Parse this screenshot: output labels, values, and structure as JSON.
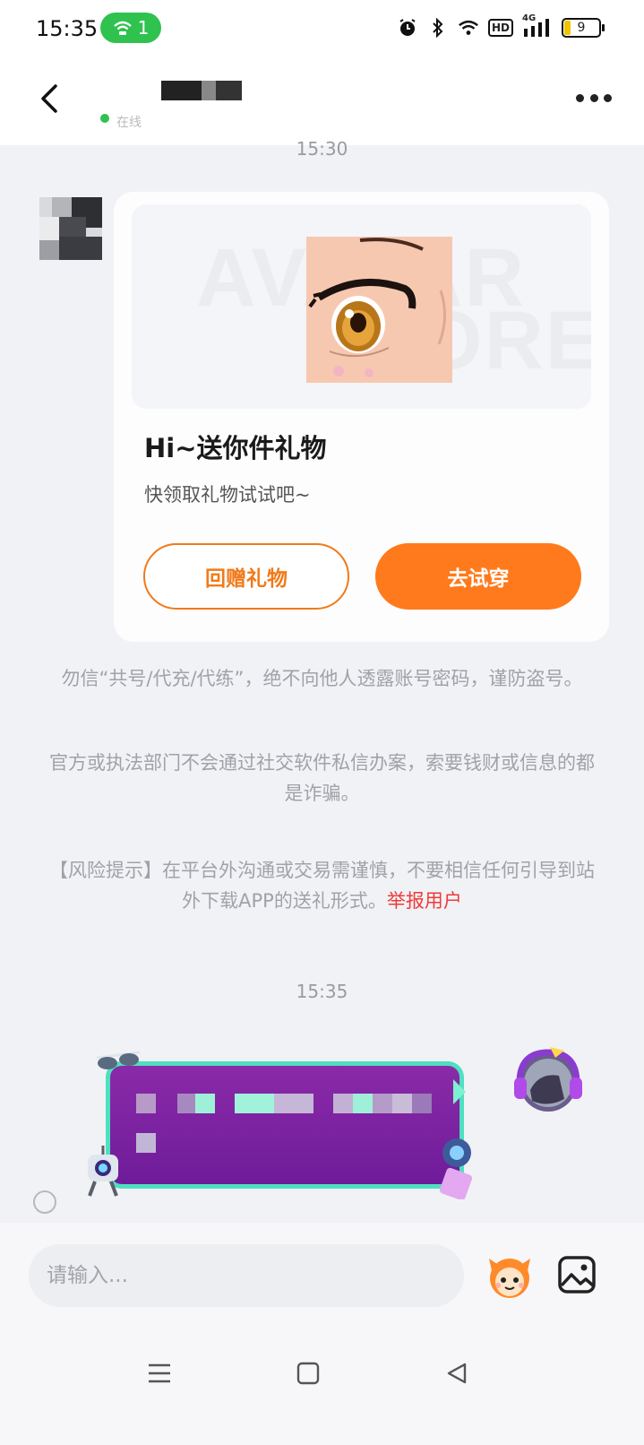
{
  "status_bar": {
    "time": "15:35",
    "hotspot_count": "1",
    "battery_level": "9",
    "network_label": "HD",
    "cellular_label": "4G"
  },
  "header": {
    "online_label": "在线"
  },
  "messages": [
    {
      "timestamp": "15:30",
      "type": "gift_card",
      "watermark_line1": "AVATAR",
      "watermark_line2": "STORE",
      "title": "Hi~送你件礼物",
      "subtitle": "快领取礼物试试吧~",
      "buttons": {
        "return_gift": "回赠礼物",
        "try_on": "去试穿"
      }
    }
  ],
  "notices": {
    "line1": "勿信“共号/代充/代练”，绝不向他人透露账号密码，谨防盗号。",
    "line2": "官方或执法部门不会通过社交软件私信办案，索要钱财或信息的都是诈骗。",
    "risk_text": "【风险提示】在平台外沟通或交易需谨慎，不要相信任何引导到站外下载APP的送礼形式。",
    "report_link": "举报用户"
  },
  "second_timestamp": "15:35",
  "input": {
    "placeholder": "请输入..."
  },
  "colors": {
    "accent": "#ff7a1c",
    "report_red": "#f03a3a",
    "online_green": "#2fc24f",
    "bubble_purple": "#7a22a0",
    "bubble_border": "#4ee0c0"
  },
  "icons": {
    "back": "chevron-left-icon",
    "more": "more-dots-icon",
    "emoji": "mascot-emoji-icon",
    "photo": "image-icon",
    "nav_menu": "menu-icon",
    "nav_home": "home-square-icon",
    "nav_back": "triangle-back-icon"
  }
}
